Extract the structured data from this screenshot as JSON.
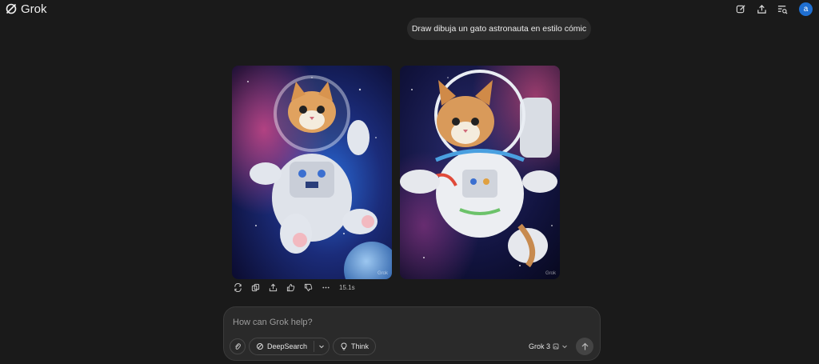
{
  "app": {
    "name": "Grok"
  },
  "header": {
    "actions": [
      {
        "icon": "edit-icon"
      },
      {
        "icon": "share-icon"
      },
      {
        "icon": "history-search-icon"
      }
    ],
    "avatar_letter": "a"
  },
  "conversation": {
    "user_message": "Draw dibuja un gato astronauta en estilo cómic",
    "images": [
      {
        "description_icon": "image",
        "watermark": "Grok"
      },
      {
        "description_icon": "image",
        "watermark": "Grok"
      }
    ],
    "actions": [
      "regenerate-icon",
      "copy-icon",
      "share-icon",
      "thumbs-up-icon",
      "thumbs-down-icon",
      "more-icon"
    ],
    "response_time": "15.1s"
  },
  "composer": {
    "placeholder": "How can Grok help?",
    "deepsearch_label": "DeepSearch",
    "think_label": "Think",
    "model_label": "Grok 3"
  },
  "colors": {
    "background": "#1a1a1a",
    "bubble": "#2b2b2b",
    "composer": "#2a2a2a",
    "avatar": "#1f6fd1"
  }
}
